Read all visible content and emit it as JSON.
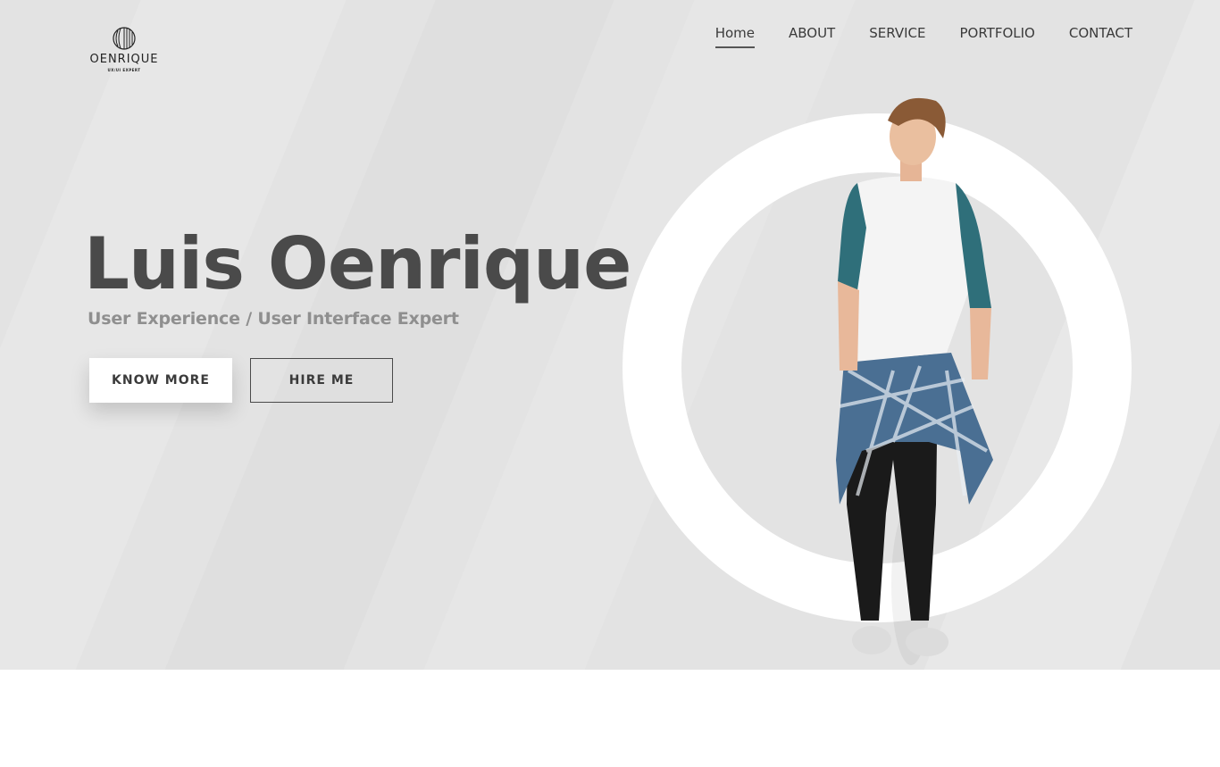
{
  "logo": {
    "name": "OENRIQUE",
    "tagline": "UX/UI EXPERT"
  },
  "nav": {
    "items": [
      {
        "label": "Home"
      },
      {
        "label": "ABOUT"
      },
      {
        "label": "SERVICE"
      },
      {
        "label": "PORTFOLIO"
      },
      {
        "label": "CONTACT"
      }
    ],
    "active_index": 0
  },
  "hero": {
    "title": "Luis Oenrique",
    "subtitle": "User Experience / User Interface Expert",
    "buttons": {
      "know_more": "KNOW MORE",
      "hire_me": "HIRE ME"
    }
  },
  "colors": {
    "hero_background": "#e3e3e3",
    "text_dark": "#4a4a4a",
    "text_muted": "#8f8f8f",
    "ring": "#ffffff",
    "shirt_sleeve": "#2f6f7a"
  }
}
